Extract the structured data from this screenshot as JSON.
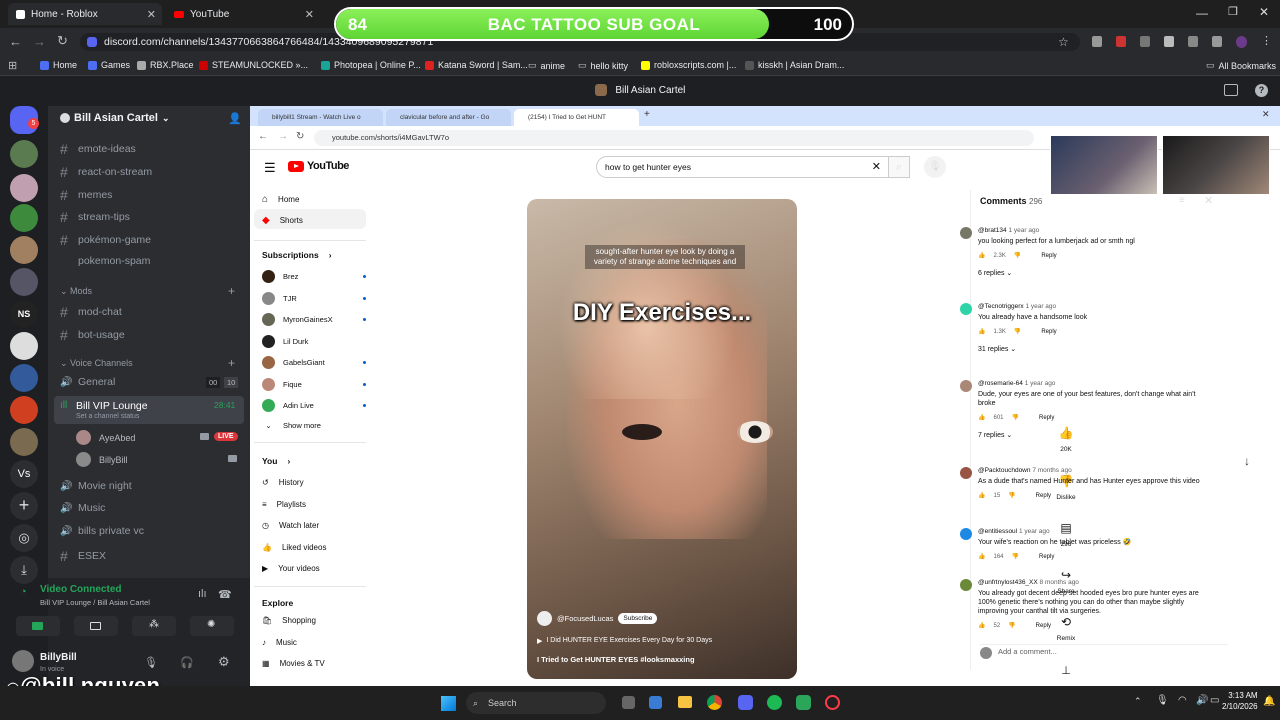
{
  "browser": {
    "tabs": [
      "Home - Roblox",
      "YouTube"
    ],
    "url": "discord.com/channels/1343770663864766484/1433409689095279871",
    "bookmarks": [
      "Home",
      "Games",
      "RBX.Place",
      "STEAMUNLOCKED »...",
      "Photopea | Online P...",
      "Katana Sword | Sam...",
      "anime",
      "hello kitty",
      "robloxscripts.com |...",
      "kisskh | Asian Dram...",
      "All Bookmarks"
    ]
  },
  "goal": {
    "current": "84",
    "target": "100",
    "label": "BAC TATTOO SUB GOAL",
    "progress": 0.84
  },
  "discord": {
    "title": "Bill Asian Cartel",
    "server": "Bill Asian Cartel",
    "channels": [
      "emote-ideas",
      "react-on-stream",
      "memes",
      "stream-tips",
      "pokémon-game",
      "pokemon-spam"
    ],
    "mods_category": "Mods",
    "mod_channels": [
      "mod-chat",
      "bot-usage"
    ],
    "voice_category": "Voice Channels",
    "voice": {
      "general": "General",
      "general_counts": [
        "00",
        "10"
      ],
      "vip": "Bill VIP Lounge",
      "vip_timer": "28:41",
      "vip_status": "Set a channel status",
      "users": [
        "AyeAbed",
        "BillyBill"
      ],
      "live": "LIVE"
    },
    "more_voice": [
      "Movie night",
      "Music",
      "bills private vc",
      "ESEX"
    ],
    "vc_status": "Video Connected",
    "vc_sub": "Bill VIP Lounge / Bill Asian Cartel",
    "user": "BillyBill",
    "user_status": "In voice",
    "rail_ns": "NS",
    "rail_vs": "Vs"
  },
  "share": {
    "tabs": [
      "billybill1 Stream - Watch Live o",
      "clavicular before and after - Go",
      "(2154) I Tried to Get HUNT"
    ],
    "url": "youtube.com/shorts/i4MGavLTW7o"
  },
  "youtube": {
    "search": "how to get hunter eyes",
    "logo": "YouTube",
    "nav": [
      "Home",
      "Shorts"
    ],
    "subs_label": "Subscriptions",
    "subs": [
      "Brez",
      "TJR",
      "MyronGainesX",
      "Lil Durk",
      "GabelsGiant",
      "Fique",
      "Adin Live",
      "Show more"
    ],
    "you_label": "You",
    "you": [
      "History",
      "Playlists",
      "Watch later",
      "Liked videos",
      "Your videos"
    ],
    "explore_label": "Explore",
    "explore": [
      "Shopping",
      "Music",
      "Movies & TV"
    ],
    "video": {
      "caption": "sought-after hunter eye look by doing a variety of strange atome techniques and",
      "overlay": "DIY Exercises...",
      "channel": "@FocusedLucas",
      "subscribe": "Subscribe",
      "title_line": "I Did HUNTER EYE Exercises Every Day for 30 Days",
      "desc": "I Tried to Get HUNTER EYES #looksmaxxing"
    },
    "actions": {
      "likes": "20K",
      "dislike": "Dislike",
      "comments": "296",
      "share": "Share",
      "remix": "Remix"
    },
    "comments_title": "Comments",
    "comments_count": "296",
    "comments": [
      {
        "user": "@brat134",
        "age": "1 year ago",
        "text": "you looking perfect for a lumberjack ad or smth ngl",
        "likes": "2.3K",
        "replies": "6 replies"
      },
      {
        "user": "@Tecnotriggerx",
        "age": "1 year ago",
        "text": "You already have a handsome look",
        "likes": "1.3K",
        "replies": "31 replies"
      },
      {
        "user": "@rosemarie-64",
        "age": "1 year ago",
        "text": "Dude, your eyes are one of your best features, don't change what ain't broke",
        "likes": "601",
        "replies": "7 replies"
      },
      {
        "user": "@Packtouchdown",
        "age": "7 months ago",
        "text": "As a dude that's named Hunter and has Hunter eyes approve this video",
        "likes": "15",
        "replies": ""
      },
      {
        "user": "@entitiessoul",
        "age": "1 year ago",
        "text": "Your wife's reaction on he tablet was priceless 🤣",
        "likes": "164",
        "replies": ""
      },
      {
        "user": "@unfrtnylost436_XX",
        "age": "8 months ago",
        "text": "You already got decent deep set hooded eyes bro pure hunter eyes are 100% genetic there's nothing you can do other than maybe slightly improving your canthal tilt via surgeries.",
        "likes": "52",
        "replies": ""
      }
    ],
    "reply": "Reply",
    "add_comment": "Add a comment..."
  },
  "taskbar": {
    "search": "Search",
    "time": "3:13 AM",
    "date": "2/10/2026"
  },
  "watermark": "@bill.nguyen"
}
